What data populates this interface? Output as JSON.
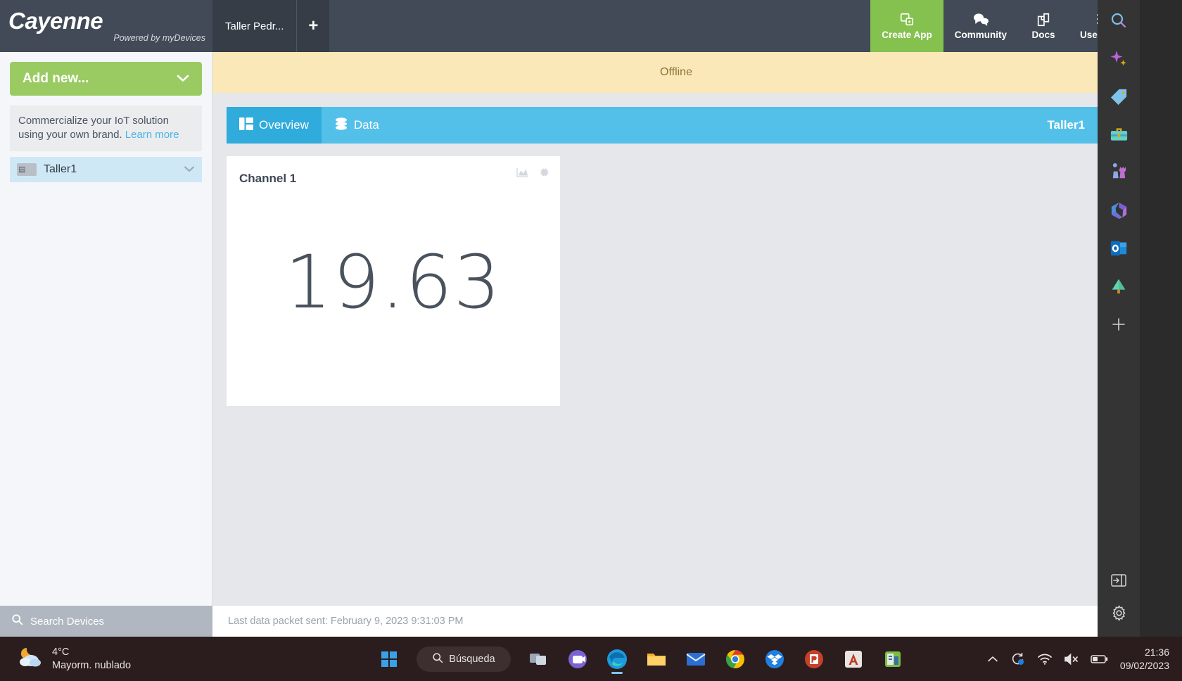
{
  "app": {
    "brand": "Cayenne",
    "brand_tagline": "Powered by myDevices",
    "tabs": [
      {
        "label": "Taller Pedr...",
        "name": "browser-tab-taller-pedro"
      }
    ],
    "add_tab_label": "+",
    "nav": [
      {
        "label": "Create App",
        "icon": "create-app-icon",
        "highlight_color": "#84c14e"
      },
      {
        "label": "Community",
        "icon": "community-icon"
      },
      {
        "label": "Docs",
        "icon": "docs-icon"
      },
      {
        "label": "User Menu",
        "icon": "hamburger-menu-icon"
      }
    ]
  },
  "sidebar": {
    "add_new_label": "Add new...",
    "promo_text": "Commercialize your IoT solution using your own brand.",
    "promo_link": "Learn more",
    "devices": [
      {
        "label": "Taller1",
        "icon": "device-icon"
      }
    ],
    "search_placeholder": "Search Devices",
    "search_value": ""
  },
  "main": {
    "status_banner": "Offline",
    "tabs": [
      {
        "label": "Overview",
        "icon": "dashboard-icon",
        "active": true
      },
      {
        "label": "Data",
        "icon": "database-icon",
        "active": false
      }
    ],
    "device_name": "Taller1",
    "settings_icon": "gear-icon",
    "widget": {
      "title": "Channel 1",
      "value": "19.63",
      "chart_icon": "chart-icon",
      "gear_icon": "gear-icon"
    },
    "footer_text": "Last data packet sent: February 9, 2023 9:31:03 PM"
  },
  "winbar": {
    "items": [
      {
        "name": "search-icon",
        "label": "Search"
      },
      {
        "name": "copilot-sparkle-icon",
        "label": "Copilot"
      },
      {
        "name": "tag-icon",
        "label": "Tag"
      },
      {
        "name": "toolbox-icon",
        "label": "Toolbox"
      },
      {
        "name": "chess-icon",
        "label": "Games"
      },
      {
        "name": "microsoft-365-icon",
        "label": "Microsoft 365"
      },
      {
        "name": "outlook-icon",
        "label": "Outlook"
      },
      {
        "name": "tree-icon",
        "label": "Tree"
      },
      {
        "name": "add-icon",
        "label": "Add"
      }
    ],
    "bottom": [
      {
        "name": "expand-sidebar-icon",
        "label": "Expand"
      },
      {
        "name": "settings-gear-icon",
        "label": "Settings"
      }
    ]
  },
  "taskbar": {
    "weather_temp": "4°C",
    "weather_desc": "Mayorm. nublado",
    "search_label": "Búsqueda",
    "apps": [
      {
        "name": "start-button-icon",
        "label": "Start"
      },
      {
        "name": "task-view-icon",
        "label": "Task View"
      },
      {
        "name": "teams-icon",
        "label": "Microsoft Teams"
      },
      {
        "name": "edge-icon",
        "label": "Microsoft Edge",
        "active": true
      },
      {
        "name": "file-explorer-icon",
        "label": "File Explorer"
      },
      {
        "name": "mail-icon",
        "label": "Mail"
      },
      {
        "name": "chrome-icon",
        "label": "Google Chrome"
      },
      {
        "name": "dropbox-icon",
        "label": "Dropbox"
      },
      {
        "name": "powerpoint-icon",
        "label": "PowerPoint"
      },
      {
        "name": "autocad-icon",
        "label": "AutoCAD"
      },
      {
        "name": "app-icon",
        "label": "App"
      }
    ],
    "tray": [
      {
        "name": "show-hidden-icons-icon"
      },
      {
        "name": "onedrive-sync-icon"
      },
      {
        "name": "wifi-icon"
      },
      {
        "name": "volume-muted-icon"
      },
      {
        "name": "battery-icon"
      }
    ],
    "time": "21:36",
    "date": "09/02/2023"
  },
  "colors": {
    "header_bg": "#414a56",
    "accent_green": "#84c14e",
    "accent_blue": "#53c0e9",
    "offline_bg": "#fbe8b8",
    "offline_text": "#8a7434"
  }
}
